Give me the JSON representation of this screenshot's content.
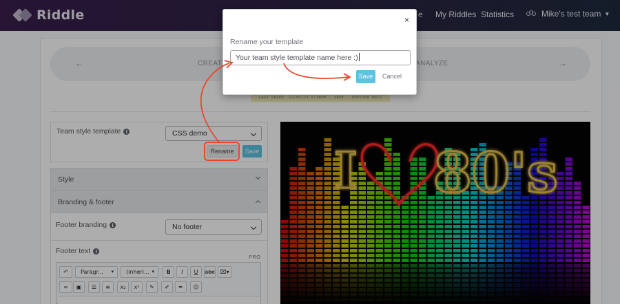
{
  "nav": {
    "logo_text": "Riddle",
    "links": [
      {
        "label": "e",
        "partial": true
      },
      {
        "label": "My Riddles"
      },
      {
        "label": "Statistics"
      }
    ],
    "team_label": "Mike's test team"
  },
  "stepper": {
    "steps": [
      "CREATE",
      "ANALYZE"
    ]
  },
  "savebar": {
    "last_saved": "LAST SAVED: 17/05/21 5:18PM",
    "save": "SAVE",
    "preview": "PREVIEW QUIZ"
  },
  "template": {
    "label": "Team style template",
    "selected": "CSS demo",
    "rename_label": "Rename",
    "save_label": "Save"
  },
  "accordions": {
    "style": "Style",
    "branding": "Branding & footer"
  },
  "branding": {
    "footer_branding_label": "Footer branding",
    "footer_branding_value": "No footer",
    "footer_text_label": "Footer text",
    "pro_badge": "PRO"
  },
  "editor": {
    "paragraph": "Paragr...",
    "font": "(inheri..."
  },
  "image": {
    "text_i": "I",
    "text_80s": "80's"
  },
  "modal": {
    "close": "×",
    "title": "Rename your template",
    "input_value": "Your team style template name here :)",
    "save_label": "Save",
    "cancel_label": "Cancel"
  },
  "colors": {
    "accent_blue": "#5bc3e0",
    "annotation_red": "#e8472b",
    "nav_bg": "#2e2346"
  }
}
